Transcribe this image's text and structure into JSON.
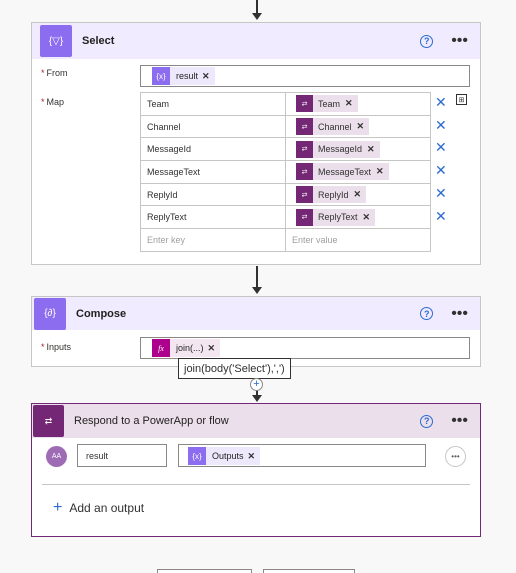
{
  "select": {
    "title": "Select",
    "from_label": "From",
    "from_token": "result",
    "map_label": "Map",
    "rows": [
      {
        "key": "Team",
        "value": "Team"
      },
      {
        "key": "Channel",
        "value": "Channel"
      },
      {
        "key": "MessageId",
        "value": "MessageId"
      },
      {
        "key": "MessageText",
        "value": "MessageText"
      },
      {
        "key": "ReplyId",
        "value": "ReplyId"
      },
      {
        "key": "ReplyText",
        "value": "ReplyText"
      }
    ],
    "key_placeholder": "Enter key",
    "value_placeholder": "Enter value"
  },
  "compose": {
    "title": "Compose",
    "inputs_label": "Inputs",
    "token": "join(...)",
    "tooltip": "join(body('Select'),',')"
  },
  "respond": {
    "title": "Respond to a PowerApp or flow",
    "output_name": "result",
    "output_token": "Outputs",
    "avatar_text": "AA",
    "add_output_label": "Add an output"
  },
  "colors": {
    "select_accent": "#8c6cef",
    "select_header_bg": "#f0ebff",
    "compose_accent": "#8c6cef",
    "fx_token": "#ad008c",
    "respond_accent": "#742774",
    "respond_header_bg": "#ebdfeb",
    "link_blue": "#2b6bd0"
  }
}
